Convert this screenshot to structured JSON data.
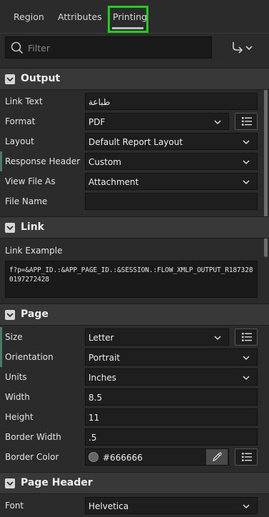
{
  "tabs": [
    {
      "label": "Region",
      "active": false
    },
    {
      "label": "Attributes",
      "active": false
    },
    {
      "label": "Printing",
      "active": true
    }
  ],
  "filter": {
    "placeholder": "Filter",
    "icon": "search-icon"
  },
  "toolbar": {
    "menu_icon": "go-to-group-icon"
  },
  "sections": {
    "output": {
      "title": "Output",
      "fields": [
        {
          "label": "Link Text",
          "value": "طباعة"
        },
        {
          "label": "Format",
          "value": "PDF"
        },
        {
          "label": "Layout",
          "value": "Default Report Layout"
        },
        {
          "label": "Response Header",
          "value": "Custom"
        },
        {
          "label": "View File As",
          "value": "Attachment"
        },
        {
          "label": "File Name",
          "value": ""
        }
      ]
    },
    "link": {
      "title": "Link",
      "example_label": "Link Example",
      "example_value": "f?p=&APP_ID.:&APP_PAGE_ID.:&SESSION.:FLOW_XMLP_OUTPUT_R1873280197272428"
    },
    "page": {
      "title": "Page",
      "fields": [
        {
          "label": "Size",
          "value": "Letter"
        },
        {
          "label": "Orientation",
          "value": "Portrait"
        },
        {
          "label": "Units",
          "value": "Inches"
        },
        {
          "label": "Width",
          "value": "8.5"
        },
        {
          "label": "Height",
          "value": "11"
        },
        {
          "label": "Border Width",
          "value": ".5"
        },
        {
          "label": "Border Color",
          "value": "#666666",
          "swatch": "#666666"
        }
      ]
    },
    "page_header": {
      "title": "Page Header",
      "fields": [
        {
          "label": "Font",
          "value": "Helvetica"
        }
      ]
    }
  },
  "colors": {
    "highlight": "#22cc22",
    "panel": "#2b2b2b",
    "section": "#383838",
    "field": "#1e1e1e"
  }
}
